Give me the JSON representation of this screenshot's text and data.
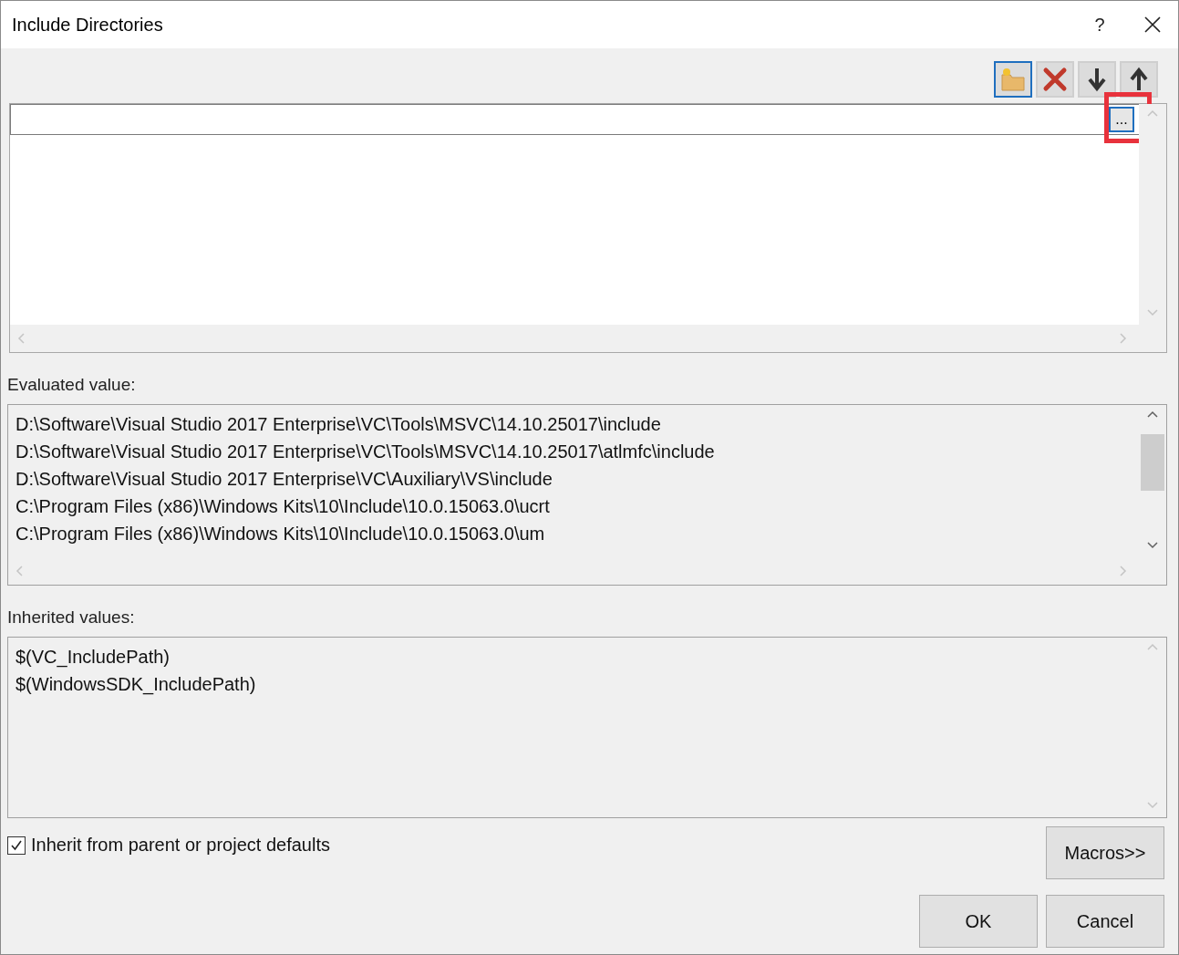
{
  "window": {
    "title": "Include Directories",
    "help": "?"
  },
  "toolbar": [
    {
      "kind": "new-folder",
      "selected": true
    },
    {
      "kind": "delete",
      "selected": false
    },
    {
      "kind": "down",
      "selected": false
    },
    {
      "kind": "up",
      "selected": false
    }
  ],
  "editor": {
    "browse_button": {
      "label": "...",
      "highlighted": true
    }
  },
  "evaluated": {
    "label": "Evaluated value:",
    "lines": [
      "D:\\Software\\Visual Studio 2017 Enterprise\\VC\\Tools\\MSVC\\14.10.25017\\include",
      "D:\\Software\\Visual Studio 2017 Enterprise\\VC\\Tools\\MSVC\\14.10.25017\\atlmfc\\include",
      "D:\\Software\\Visual Studio 2017 Enterprise\\VC\\Auxiliary\\VS\\include",
      "C:\\Program Files (x86)\\Windows Kits\\10\\Include\\10.0.15063.0\\ucrt",
      "C:\\Program Files (x86)\\Windows Kits\\10\\Include\\10.0.15063.0\\um"
    ]
  },
  "inherited": {
    "label": "Inherited values:",
    "lines": [
      "$(VC_IncludePath)",
      "$(WindowsSDK_IncludePath)"
    ]
  },
  "inherit_checkbox": {
    "label": "Inherit from parent or project defaults",
    "checked": true
  },
  "buttons": [
    {
      "kind": "macros",
      "label": "Macros>>"
    },
    {
      "kind": "ok",
      "label": "OK"
    },
    {
      "kind": "cancel",
      "label": "Cancel"
    }
  ]
}
